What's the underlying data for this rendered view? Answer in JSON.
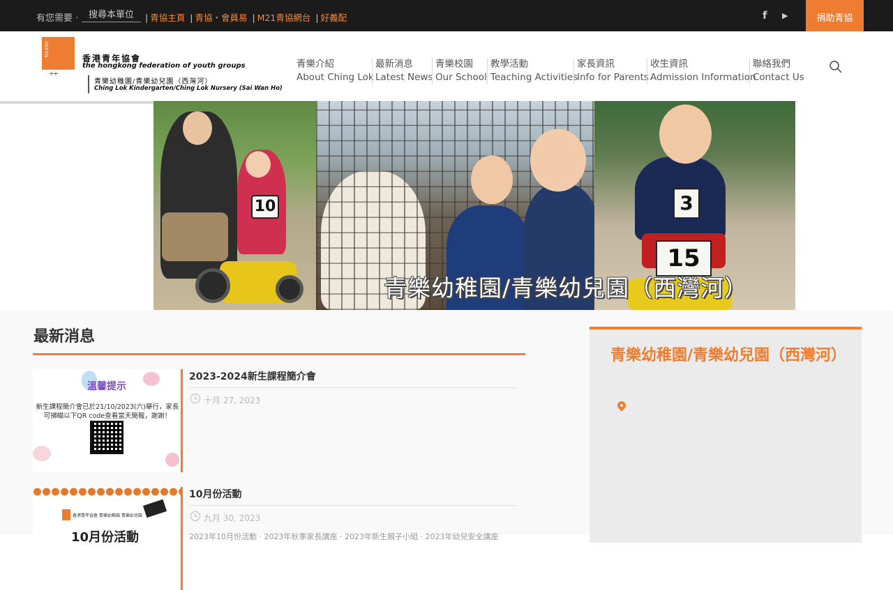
{
  "topbar": {
    "search_label": "有您需要 ·",
    "search_placeholder": "搜尋本單位",
    "links": [
      "青協主頁",
      "青協・會員易",
      "M21青協網台",
      "好義配"
    ],
    "social": {
      "facebook_icon": "facebook-icon",
      "youtube_icon": "play-icon"
    },
    "donate_label": "捐助青協"
  },
  "logo": {
    "org_cn": "香港青年協會",
    "org_en": "the hongkong federation of youth groups",
    "unit_cn": "青樂幼稚園/青樂幼兒園（西灣河）",
    "unit_en": "Ching Lok Kindergarten/Ching Lok Nursery (Sai Wan Ho)",
    "mark_text": "HKFYG"
  },
  "nav": [
    {
      "cn": "青樂介紹",
      "en": "About Ching Lok"
    },
    {
      "cn": "最新消息",
      "en": "Latest News"
    },
    {
      "cn": "青樂校園",
      "en": "Our School"
    },
    {
      "cn": "教學活動",
      "en": "Teaching Activities"
    },
    {
      "cn": "家長資訊",
      "en": "Info for Parents"
    },
    {
      "cn": "收生資訊",
      "en": "Admission Information"
    },
    {
      "cn": "聯絡我們",
      "en": "Contact Us"
    }
  ],
  "banner": {
    "caption": "青樂幼稚園/青樂幼兒園（西灣河）",
    "signs": [
      "10",
      "3",
      "15"
    ]
  },
  "news": {
    "section_title": "最新消息",
    "items": [
      {
        "title": "2023-2024新生課程簡介會",
        "date": "十月 27, 2023",
        "thumb_title": "溫馨提示",
        "thumb_text": "新生課程簡介會已於21/10/2023(六)舉行，家長可掃瞄以下QR code查看當天簡報，謝謝！"
      },
      {
        "title": "10月份活動",
        "date": "九月 30, 2023",
        "thumb_header": "香港青年協會 青樂幼稚園 青樂幼兒園",
        "thumb_big": "10月份活動",
        "excerpt": "2023年10月份活動 · 2023年秋季家長講座 · 2023年新生親子小組 · 2023年幼兒安全講座"
      }
    ]
  },
  "sidebar": {
    "title": "青樂幼稚園/青樂幼兒園（西灣河）",
    "location_icon": "map-pin-icon"
  },
  "colors": {
    "accent": "#ef7d31",
    "topbar": "#1b1b1b",
    "link": "#f08a3c"
  }
}
